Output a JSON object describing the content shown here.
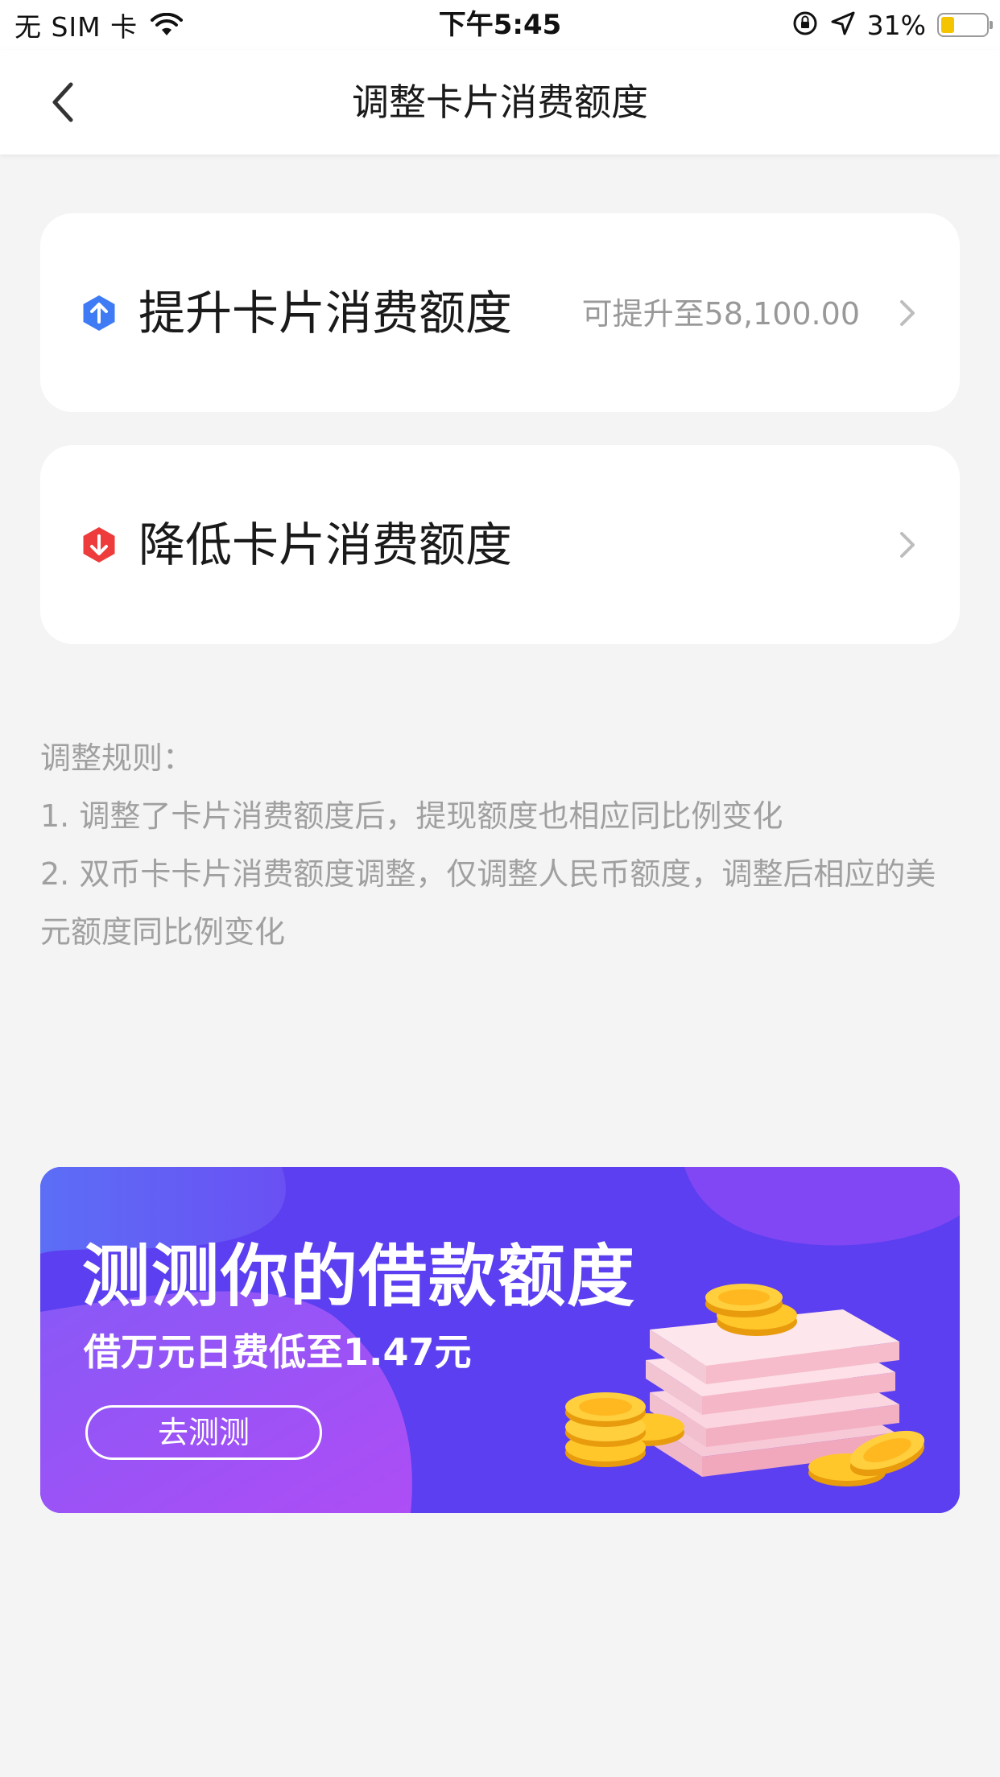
{
  "status_bar": {
    "carrier": "无 SIM 卡",
    "time": "下午5:45",
    "battery_percent": "31%",
    "battery_level": 0.31,
    "icons": [
      "wifi-icon",
      "orientation-lock-icon",
      "location-arrow-icon",
      "battery-icon"
    ]
  },
  "nav": {
    "title": "调整卡片消费额度",
    "back_icon": "chevron-left-icon"
  },
  "options": {
    "increase": {
      "label": "提升卡片消费额度",
      "hint": "可提升至58,100.00",
      "icon": "arrow-up-hex-icon",
      "icon_color": "#3f7bf5"
    },
    "decrease": {
      "label": "降低卡片消费额度",
      "icon": "arrow-down-hex-icon",
      "icon_color": "#ee3b3b"
    }
  },
  "rules": {
    "heading": "调整规则：",
    "items": [
      "1. 调整了卡片消费额度后，提现额度也相应同比例变化",
      "2. 双币卡卡片消费额度调整，仅调整人民币额度，调整后相应的美元额度同比例变化"
    ]
  },
  "banner": {
    "title": "测测你的借款额度",
    "subtitle": "借万元日费低至1.47元",
    "button": "去测测",
    "colors": {
      "primary": "#5b3ff0",
      "accent": "#a64bf4",
      "coin": "#ffb81f"
    }
  }
}
